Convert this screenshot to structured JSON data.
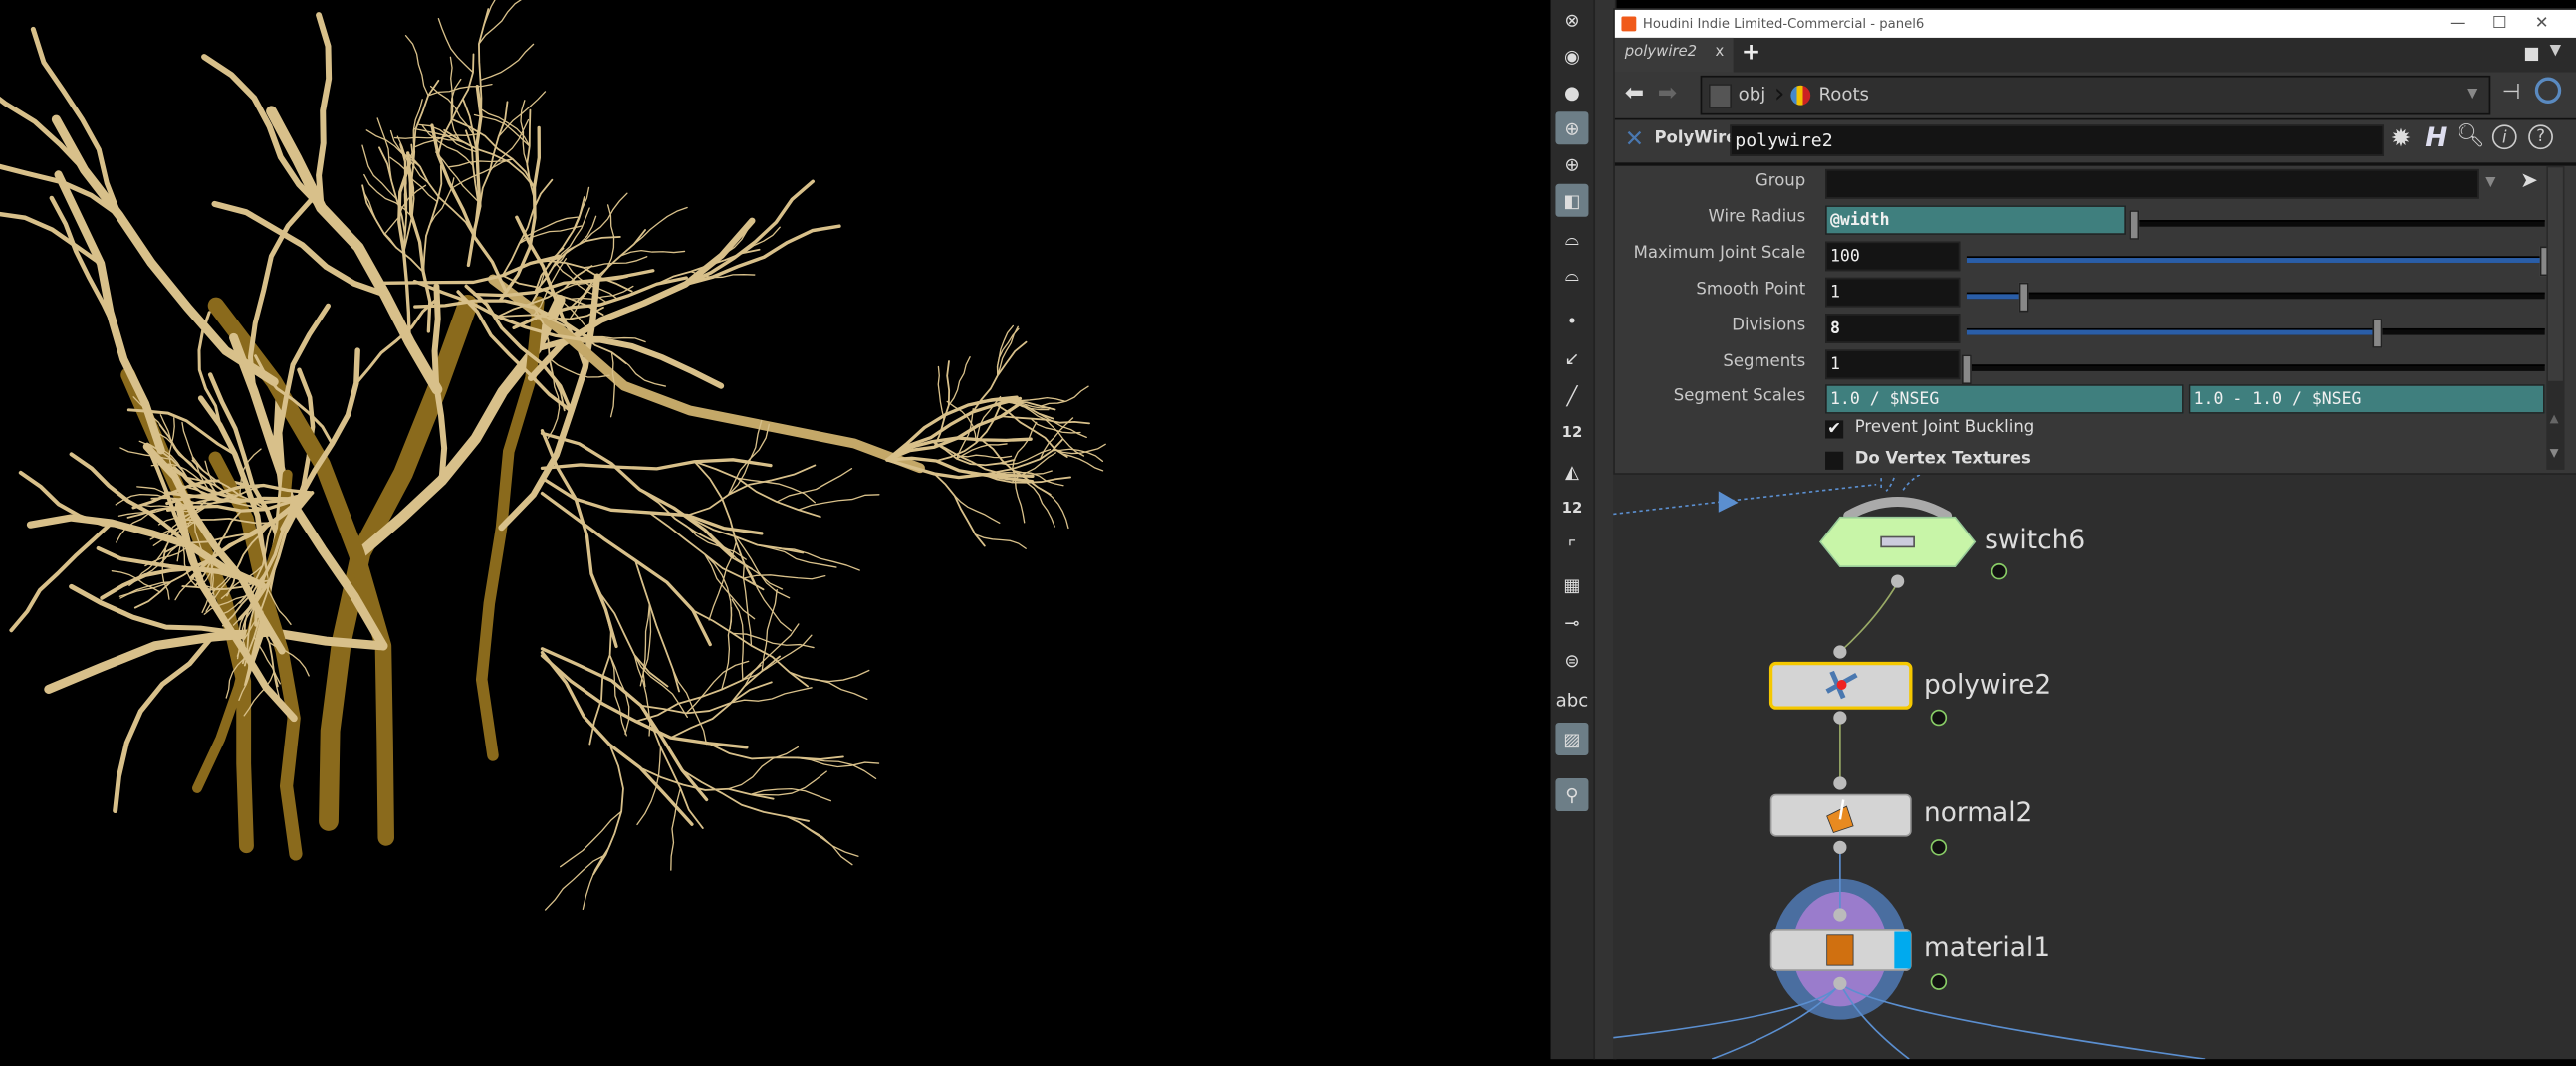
{
  "window": {
    "title": "Houdini Indie Limited-Commercial - panel6",
    "controls": [
      "minimize",
      "maximize",
      "close"
    ]
  },
  "tab": {
    "label": "polywire2",
    "close": "x",
    "add": "+"
  },
  "nav": {
    "path": [
      {
        "label": "obj",
        "icon": "obj-icon"
      },
      {
        "label": "Roots",
        "icon": "geo-icon"
      }
    ]
  },
  "node_header": {
    "type": "PolyWire",
    "name": "polywire2"
  },
  "params": {
    "group": {
      "label": "Group",
      "value": ""
    },
    "wire_radius": {
      "label": "Wire Radius",
      "value": "@width"
    },
    "max_joint_scale": {
      "label": "Maximum Joint Scale",
      "value": "100",
      "slider": 1.0
    },
    "smooth_point": {
      "label": "Smooth Point",
      "value": "1",
      "slider": 0.1
    },
    "divisions": {
      "label": "Divisions",
      "value": "8",
      "slider": 0.71
    },
    "segments": {
      "label": "Segments",
      "value": "1",
      "slider": 0.0
    },
    "segment_scales": {
      "label": "Segment Scales",
      "value1": "1.0 / $NSEG",
      "value2": "1.0 - 1.0 / $NSEG"
    },
    "prevent_joint_buckling": {
      "label": "Prevent Joint Buckling",
      "checked": true
    },
    "do_vertex_textures": {
      "label": "Do Vertex Textures",
      "checked": false
    }
  },
  "nodes": [
    {
      "name": "switch6",
      "type": "switch",
      "color": "#c8f5a8"
    },
    {
      "name": "polywire2",
      "type": "polywire",
      "selected": true
    },
    {
      "name": "normal2",
      "type": "normal"
    },
    {
      "name": "material1",
      "type": "material"
    }
  ],
  "toolbar": {
    "icons": [
      "light-off-icon",
      "area-light-icon",
      "point-light-icon",
      "add-light-icon",
      "spot-light-icon",
      "environment-icon",
      "camera-icon",
      "stereo-camera-icon",
      "point-icon",
      "curve-icon",
      "brush-icon",
      "point-number-icon",
      "primitive-icon",
      "primitive-number-icon",
      "bezier-icon",
      "bounding-box-icon",
      "pivot-icon",
      "template-icon",
      "abc-label",
      "background-image-icon",
      "pin-icon"
    ],
    "abc": "abc",
    "num12": "12"
  },
  "colors": {
    "accent_teal": "#3f7f7e",
    "slider_blue": "#2a5ea8",
    "selected_node": "#f5c800",
    "material_ring": "#4a6ea0",
    "material_inner": "#9a7ccc",
    "root_dark": "#8a6a1c",
    "root_light": "#d8c08a"
  }
}
